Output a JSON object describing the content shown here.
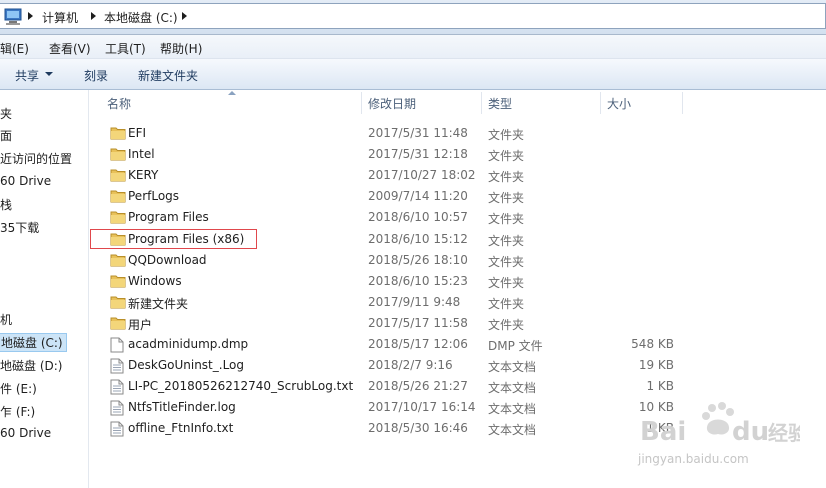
{
  "address": {
    "crumbs": [
      "计算机",
      "本地磁盘 (C:)"
    ]
  },
  "menu": {
    "items": [
      "编辑(E)",
      "查看(V)",
      "工具(T)",
      "帮助(H)"
    ]
  },
  "commands": {
    "share": "共享",
    "burn": "刻录",
    "new_folder": "新建文件夹"
  },
  "nav": {
    "items": [
      "夹",
      "面",
      "近访问的位置",
      "60 Drive",
      "栈",
      "35下载",
      "机",
      "地磁盘 (C:)",
      "地磁盘 (D:)",
      "件 (E:)",
      "乍 (F:)",
      "60 Drive"
    ]
  },
  "columns": {
    "name": "名称",
    "date": "修改日期",
    "type": "类型",
    "size": "大小"
  },
  "files": [
    {
      "name": "EFI",
      "date": "2017/5/31 11:48",
      "type": "文件夹",
      "size": "",
      "icon": "folder-icon"
    },
    {
      "name": "Intel",
      "date": "2017/5/31 12:18",
      "type": "文件夹",
      "size": "",
      "icon": "folder-icon"
    },
    {
      "name": "KERY",
      "date": "2017/10/27 18:02",
      "type": "文件夹",
      "size": "",
      "icon": "folder-icon"
    },
    {
      "name": "PerfLogs",
      "date": "2009/7/14 11:20",
      "type": "文件夹",
      "size": "",
      "icon": "folder-icon"
    },
    {
      "name": "Program Files",
      "date": "2018/6/10 10:57",
      "type": "文件夹",
      "size": "",
      "icon": "folder-icon"
    },
    {
      "name": "Program Files (x86)",
      "date": "2018/6/10 15:12",
      "type": "文件夹",
      "size": "",
      "icon": "folder-icon"
    },
    {
      "name": "QQDownload",
      "date": "2018/5/26 18:10",
      "type": "文件夹",
      "size": "",
      "icon": "folder-icon"
    },
    {
      "name": "Windows",
      "date": "2018/6/10 15:23",
      "type": "文件夹",
      "size": "",
      "icon": "folder-icon"
    },
    {
      "name": "新建文件夹",
      "date": "2017/9/11 9:48",
      "type": "文件夹",
      "size": "",
      "icon": "folder-icon"
    },
    {
      "name": "用户",
      "date": "2017/5/17 11:58",
      "type": "文件夹",
      "size": "",
      "icon": "folder-icon"
    },
    {
      "name": "acadminidump.dmp",
      "date": "2018/5/17 12:06",
      "type": "DMP 文件",
      "size": "548 KB",
      "icon": "file-icon"
    },
    {
      "name": "DeskGoUninst_.Log",
      "date": "2018/2/7 9:16",
      "type": "文本文档",
      "size": "19 KB",
      "icon": "text-file-icon"
    },
    {
      "name": "LI-PC_20180526212740_ScrubLog.txt",
      "date": "2018/5/26 21:27",
      "type": "文本文档",
      "size": "1 KB",
      "icon": "text-file-icon"
    },
    {
      "name": "NtfsTitleFinder.log",
      "date": "2017/10/17 16:14",
      "type": "文本文档",
      "size": "10 KB",
      "icon": "text-file-icon"
    },
    {
      "name": "offline_FtnInfo.txt",
      "date": "2018/5/30 16:46",
      "type": "文本文档",
      "size": "1 KB",
      "icon": "text-file-icon"
    }
  ],
  "watermark": {
    "url": "jingyan.baidu.com"
  },
  "colors": {
    "folder": "#e8c15a",
    "selection": "#cce4f7",
    "highlight_box": "#e0474c"
  }
}
